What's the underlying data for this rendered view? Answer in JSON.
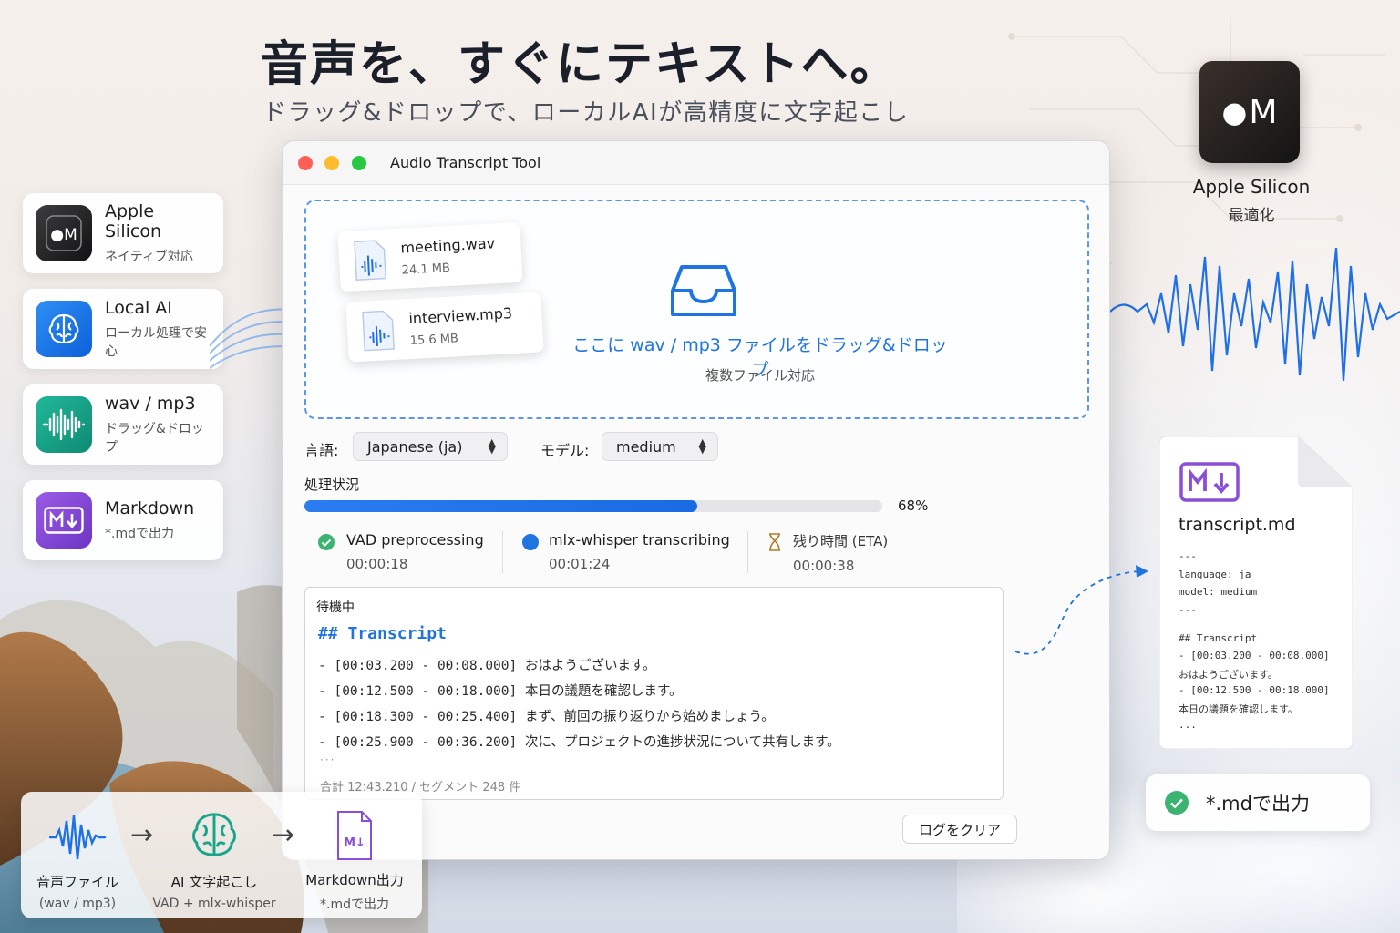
{
  "hero": {
    "title": "音声を、すぐにテキストへ。",
    "subtitle": "ドラッグ&ドロップで、ローカルAIが高精度に文字起こし"
  },
  "features": [
    {
      "title": "Apple Silicon",
      "sub": "ネイティブ対応",
      "icon": "apple-m-chip-icon"
    },
    {
      "title": "Local AI",
      "sub": "ローカル処理で安心",
      "icon": "brain-icon"
    },
    {
      "title": "wav / mp3",
      "sub": "ドラッグ&ドロップ",
      "icon": "waveform-icon"
    },
    {
      "title": "Markdown",
      "sub": "*.mdで出力",
      "icon": "markdown-icon"
    }
  ],
  "chip": {
    "badge": "M",
    "label": "Apple Silicon",
    "sub": "最適化"
  },
  "window": {
    "title": "Audio Transcript Tool",
    "drop": {
      "main": "ここに wav / mp3 ファイルをドラッグ&ドロップ",
      "sub": "複数ファイル対応",
      "files": [
        {
          "name": "meeting.wav",
          "size": "24.1 MB"
        },
        {
          "name": "interview.mp3",
          "size": "15.6 MB"
        }
      ]
    },
    "language": {
      "label": "言語:",
      "value": "Japanese (ja)"
    },
    "model": {
      "label": "モデル:",
      "value": "medium"
    },
    "status": {
      "heading": "処理状況",
      "progress": 0.68,
      "percent": "68%",
      "steps": [
        {
          "name": "VAD preprocessing",
          "time": "00:00:18",
          "state": "done"
        },
        {
          "name": "mlx-whisper transcribing",
          "time": "00:01:24",
          "state": "active"
        },
        {
          "name": "残り時間 (ETA)",
          "time": "00:00:38",
          "state": "eta"
        }
      ]
    },
    "log": {
      "state": "待機中",
      "heading": "## Transcript",
      "lines": [
        "- [00:03.200 - 00:08.000] おはようございます。",
        "- [00:12.500 - 00:18.000] 本日の議題を確認します。",
        "- [00:18.300 - 00:25.400] まず、前回の振り返りから始めましょう。",
        "- [00:25.900 - 00:36.200] 次に、プロジェクトの進捗状況について共有します。"
      ],
      "ellipsis": "···",
      "total": "合計 12:43.210 / セグメント 248 件"
    },
    "clear_button": "ログをクリア"
  },
  "pipeline": [
    {
      "title": "音声ファイル",
      "sub": "(wav / mp3)"
    },
    {
      "title": "AI 文字起こし",
      "sub": "VAD + mlx-whisper"
    },
    {
      "title": "Markdown出力",
      "sub": "*.mdで出力"
    }
  ],
  "doc": {
    "filename": "transcript.md",
    "lines": [
      "---",
      "language: ja",
      "model: medium",
      "---",
      "",
      "## Transcript",
      "- [00:03.200 - 00:08.000]",
      "  おはようございます。",
      "- [00:12.500 - 00:18.000]",
      "  本日の議題を確認します。",
      "  ..."
    ]
  },
  "md_pill": "*.mdで出力",
  "colors": {
    "accent": "#1f74e0",
    "success": "#3cb371",
    "markdown": "#8a4fd6",
    "waveform": "#1f6fe8"
  }
}
